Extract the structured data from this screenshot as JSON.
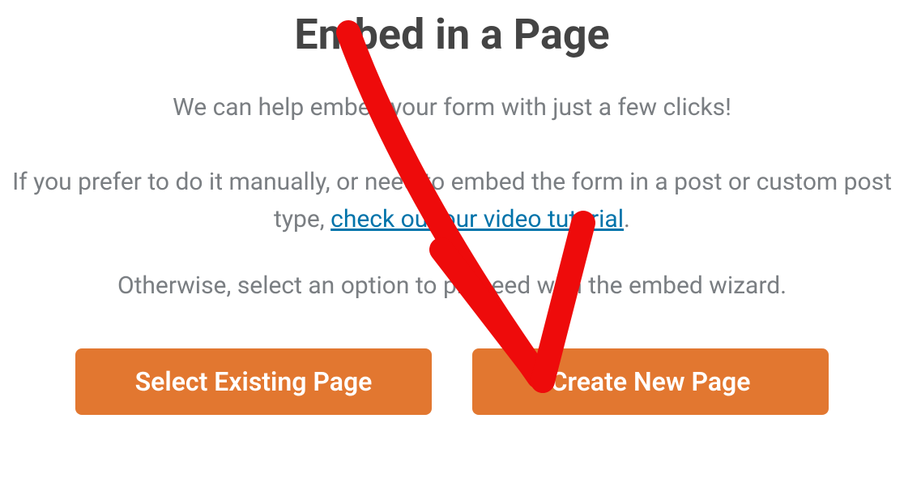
{
  "modal": {
    "title": "Embed in a Page",
    "subtitle": "We can help embed your form with just a few clicks!",
    "para_before": "If you prefer to do it manually, or need to embed the form in a post or custom post type, ",
    "link_text": "check out our video tutorial",
    "para_after": ".",
    "para2": "Otherwise, select an option to proceed with the embed wizard.",
    "buttons": {
      "select_existing": "Select Existing Page",
      "create_new": "Create New Page"
    }
  },
  "annotation": {
    "type": "arrow",
    "color": "#ee0b0b",
    "points_to": "create-new-page-button"
  }
}
